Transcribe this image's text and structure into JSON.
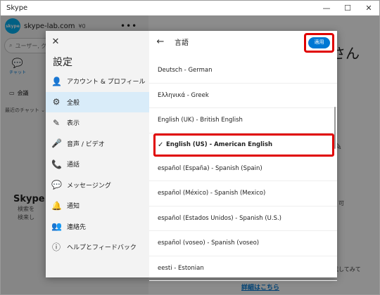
{
  "window": {
    "title": "Skype",
    "minimize": "—",
    "maximize": "☐",
    "close": "✕"
  },
  "background": {
    "logo": "skype",
    "account": "skype-lab.com",
    "credit": "¥0",
    "more": "•••",
    "search_placeholder": "ユーザー, グル",
    "chat_tab": "チャット",
    "meet_button": "会議",
    "recent_chats": "最近のチャット ⌄",
    "promo_title": "Skype で",
    "promo_text_1": "検索を",
    "promo_text_2": "検来し",
    "greeting_suffix": "さん",
    "right_text_1": "可",
    "right_text_2": "試してみて",
    "learn_more": "詳細はこちら"
  },
  "settings": {
    "close_icon": "✕",
    "title": "設定",
    "nav": [
      {
        "label": "アカウント & プロフィール",
        "icon": "person-icon",
        "glyph": "👤",
        "active": false
      },
      {
        "label": "全般",
        "icon": "gear-icon",
        "glyph": "⚙",
        "active": true
      },
      {
        "label": "表示",
        "icon": "magic-wand-icon",
        "glyph": "✎",
        "active": false
      },
      {
        "label": "音声 / ビデオ",
        "icon": "microphone-icon",
        "glyph": "🎤",
        "active": false
      },
      {
        "label": "通話",
        "icon": "phone-icon",
        "glyph": "📞",
        "active": false
      },
      {
        "label": "メッセージング",
        "icon": "message-icon",
        "glyph": "💬",
        "active": false
      },
      {
        "label": "通知",
        "icon": "bell-icon",
        "glyph": "🔔",
        "active": false
      },
      {
        "label": "連絡先",
        "icon": "contacts-icon",
        "glyph": "👥",
        "active": false
      },
      {
        "label": "ヘルプとフィードバック",
        "icon": "info-icon",
        "glyph": "ⓘ",
        "active": false
      }
    ]
  },
  "language": {
    "back_icon": "←",
    "title": "言語",
    "apply": "適用",
    "check": "✓",
    "items": [
      "Deutsch - German",
      "Ελληνικά - Greek",
      "English (UK) - British English",
      "English (US) - American English",
      "español (España) - Spanish (Spain)",
      "español (México) - Spanish (Mexico)",
      "español (Estados Unidos) - Spanish (U.S.)",
      "español (voseo) - Spanish (voseo)",
      "eesti - Estonian"
    ],
    "selected_index": 3
  },
  "colors": {
    "accent": "#0078d4",
    "highlight": "#e00000",
    "active_nav": "#d9ecf9"
  }
}
